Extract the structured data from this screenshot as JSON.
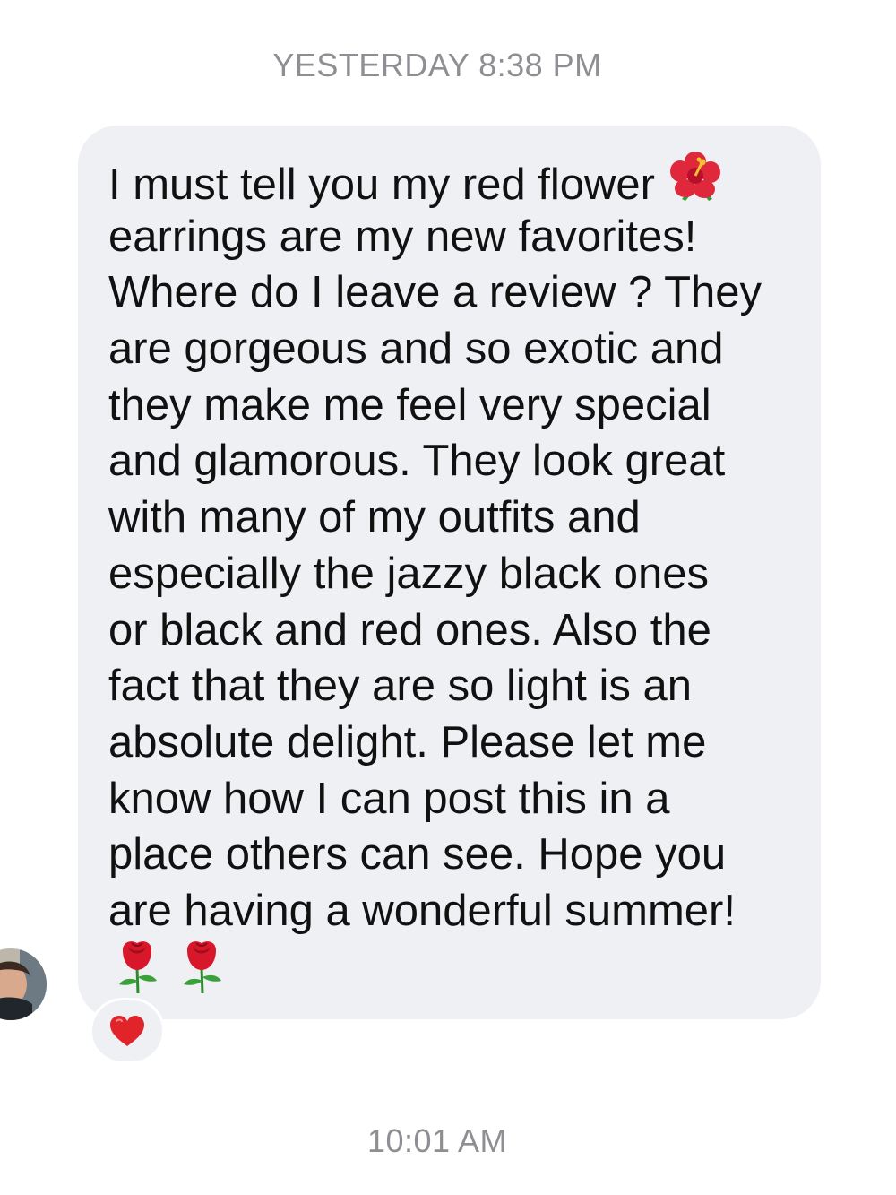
{
  "conversation": {
    "timestamp_top": "YESTERDAY 8:38 PM",
    "timestamp_bottom": "10:01 AM"
  },
  "message": {
    "lines": [
      "I must tell you my red flower",
      "earrings are my new favorites!",
      "Where do I leave a review ? They",
      "are gorgeous and so exotic and",
      "they make me feel very special",
      "and glamorous. They look great",
      "with many of my outfits and",
      "especially the jazzy black ones",
      "or black and red ones. Also the",
      "fact that they are so light is an",
      "absolute delight. Please let me",
      "know how I can post this in a",
      "place others can see. Hope you",
      "are having a wonderful summer!"
    ],
    "inline_emoji_icon": "hibiscus-icon",
    "trailing_emoji_icons": [
      "rose-icon",
      "rose-icon"
    ],
    "bubble_color": "#eef0f3",
    "text_color": "#111111"
  },
  "reaction": {
    "icon": "heart-icon",
    "color": "#e0242a"
  },
  "sender": {
    "avatar_icon": "avatar"
  }
}
